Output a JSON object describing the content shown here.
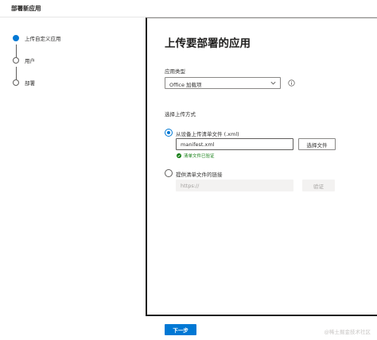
{
  "header": {
    "title": "部署新应用"
  },
  "steps": [
    {
      "label": "上传自定义应用",
      "active": true
    },
    {
      "label": "用户",
      "active": false
    },
    {
      "label": "部署",
      "active": false
    }
  ],
  "panel": {
    "title": "上传要部署的应用",
    "app_type": {
      "label": "应用类型",
      "value": "Office 加载项"
    },
    "upload_method": {
      "label": "选择上传方式",
      "option_device": {
        "label": "从设备上传清单文件 (.xml)",
        "file_value": "manifest.xml",
        "choose_button": "选择文件",
        "validation_text": "清单文件已验证"
      },
      "option_link": {
        "label": "提供清单文件的链接",
        "url_placeholder": "https://",
        "validate_button": "验证"
      }
    }
  },
  "footer": {
    "next_button": "下一步",
    "watermark": "@稀土掘金技术社区"
  },
  "colors": {
    "accent": "#0078d4",
    "success": "#107c10",
    "text": "#201f1e"
  }
}
